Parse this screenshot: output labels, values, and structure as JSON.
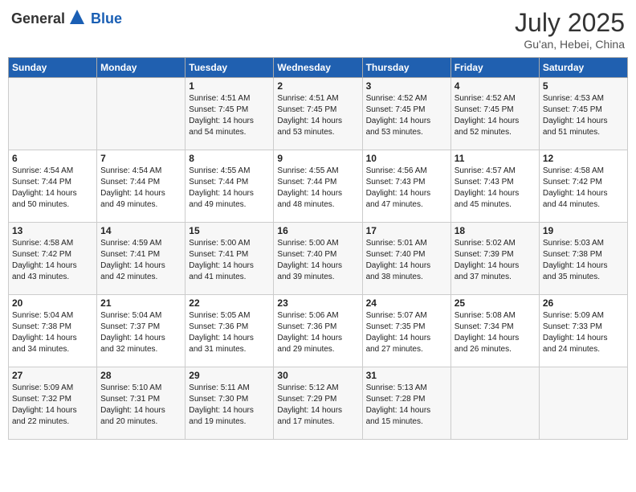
{
  "logo": {
    "general": "General",
    "blue": "Blue"
  },
  "title": "July 2025",
  "location": "Gu'an, Hebei, China",
  "days_header": [
    "Sunday",
    "Monday",
    "Tuesday",
    "Wednesday",
    "Thursday",
    "Friday",
    "Saturday"
  ],
  "weeks": [
    [
      {
        "day": "",
        "info": ""
      },
      {
        "day": "",
        "info": ""
      },
      {
        "day": "1",
        "info": "Sunrise: 4:51 AM\nSunset: 7:45 PM\nDaylight: 14 hours\nand 54 minutes."
      },
      {
        "day": "2",
        "info": "Sunrise: 4:51 AM\nSunset: 7:45 PM\nDaylight: 14 hours\nand 53 minutes."
      },
      {
        "day": "3",
        "info": "Sunrise: 4:52 AM\nSunset: 7:45 PM\nDaylight: 14 hours\nand 53 minutes."
      },
      {
        "day": "4",
        "info": "Sunrise: 4:52 AM\nSunset: 7:45 PM\nDaylight: 14 hours\nand 52 minutes."
      },
      {
        "day": "5",
        "info": "Sunrise: 4:53 AM\nSunset: 7:45 PM\nDaylight: 14 hours\nand 51 minutes."
      }
    ],
    [
      {
        "day": "6",
        "info": "Sunrise: 4:54 AM\nSunset: 7:44 PM\nDaylight: 14 hours\nand 50 minutes."
      },
      {
        "day": "7",
        "info": "Sunrise: 4:54 AM\nSunset: 7:44 PM\nDaylight: 14 hours\nand 49 minutes."
      },
      {
        "day": "8",
        "info": "Sunrise: 4:55 AM\nSunset: 7:44 PM\nDaylight: 14 hours\nand 49 minutes."
      },
      {
        "day": "9",
        "info": "Sunrise: 4:55 AM\nSunset: 7:44 PM\nDaylight: 14 hours\nand 48 minutes."
      },
      {
        "day": "10",
        "info": "Sunrise: 4:56 AM\nSunset: 7:43 PM\nDaylight: 14 hours\nand 47 minutes."
      },
      {
        "day": "11",
        "info": "Sunrise: 4:57 AM\nSunset: 7:43 PM\nDaylight: 14 hours\nand 45 minutes."
      },
      {
        "day": "12",
        "info": "Sunrise: 4:58 AM\nSunset: 7:42 PM\nDaylight: 14 hours\nand 44 minutes."
      }
    ],
    [
      {
        "day": "13",
        "info": "Sunrise: 4:58 AM\nSunset: 7:42 PM\nDaylight: 14 hours\nand 43 minutes."
      },
      {
        "day": "14",
        "info": "Sunrise: 4:59 AM\nSunset: 7:41 PM\nDaylight: 14 hours\nand 42 minutes."
      },
      {
        "day": "15",
        "info": "Sunrise: 5:00 AM\nSunset: 7:41 PM\nDaylight: 14 hours\nand 41 minutes."
      },
      {
        "day": "16",
        "info": "Sunrise: 5:00 AM\nSunset: 7:40 PM\nDaylight: 14 hours\nand 39 minutes."
      },
      {
        "day": "17",
        "info": "Sunrise: 5:01 AM\nSunset: 7:40 PM\nDaylight: 14 hours\nand 38 minutes."
      },
      {
        "day": "18",
        "info": "Sunrise: 5:02 AM\nSunset: 7:39 PM\nDaylight: 14 hours\nand 37 minutes."
      },
      {
        "day": "19",
        "info": "Sunrise: 5:03 AM\nSunset: 7:38 PM\nDaylight: 14 hours\nand 35 minutes."
      }
    ],
    [
      {
        "day": "20",
        "info": "Sunrise: 5:04 AM\nSunset: 7:38 PM\nDaylight: 14 hours\nand 34 minutes."
      },
      {
        "day": "21",
        "info": "Sunrise: 5:04 AM\nSunset: 7:37 PM\nDaylight: 14 hours\nand 32 minutes."
      },
      {
        "day": "22",
        "info": "Sunrise: 5:05 AM\nSunset: 7:36 PM\nDaylight: 14 hours\nand 31 minutes."
      },
      {
        "day": "23",
        "info": "Sunrise: 5:06 AM\nSunset: 7:36 PM\nDaylight: 14 hours\nand 29 minutes."
      },
      {
        "day": "24",
        "info": "Sunrise: 5:07 AM\nSunset: 7:35 PM\nDaylight: 14 hours\nand 27 minutes."
      },
      {
        "day": "25",
        "info": "Sunrise: 5:08 AM\nSunset: 7:34 PM\nDaylight: 14 hours\nand 26 minutes."
      },
      {
        "day": "26",
        "info": "Sunrise: 5:09 AM\nSunset: 7:33 PM\nDaylight: 14 hours\nand 24 minutes."
      }
    ],
    [
      {
        "day": "27",
        "info": "Sunrise: 5:09 AM\nSunset: 7:32 PM\nDaylight: 14 hours\nand 22 minutes."
      },
      {
        "day": "28",
        "info": "Sunrise: 5:10 AM\nSunset: 7:31 PM\nDaylight: 14 hours\nand 20 minutes."
      },
      {
        "day": "29",
        "info": "Sunrise: 5:11 AM\nSunset: 7:30 PM\nDaylight: 14 hours\nand 19 minutes."
      },
      {
        "day": "30",
        "info": "Sunrise: 5:12 AM\nSunset: 7:29 PM\nDaylight: 14 hours\nand 17 minutes."
      },
      {
        "day": "31",
        "info": "Sunrise: 5:13 AM\nSunset: 7:28 PM\nDaylight: 14 hours\nand 15 minutes."
      },
      {
        "day": "",
        "info": ""
      },
      {
        "day": "",
        "info": ""
      }
    ]
  ]
}
